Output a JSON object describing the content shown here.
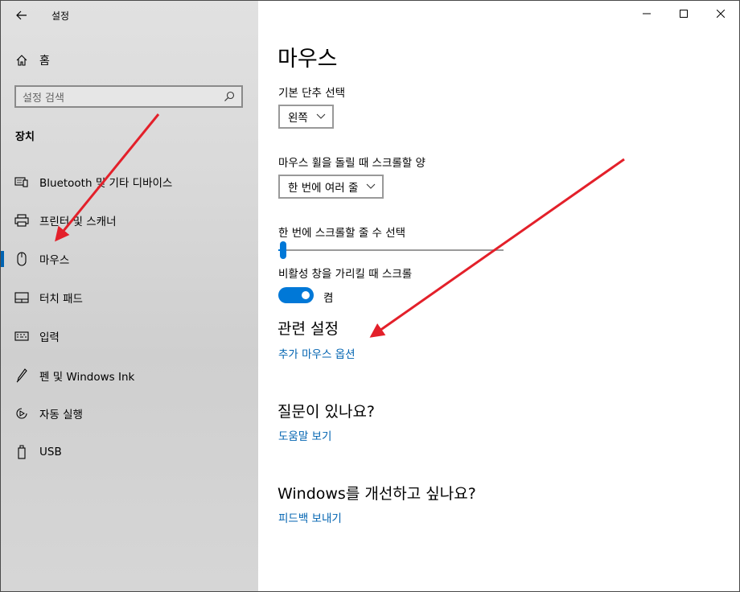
{
  "window": {
    "title": "설정",
    "controls": [
      "minimize",
      "maximize",
      "close"
    ]
  },
  "sidebar": {
    "home_label": "홈",
    "search_placeholder": "설정 검색",
    "section_title": "장치",
    "selected_index": 2,
    "items": [
      {
        "label": "Bluetooth 및 기타 디바이스",
        "icon": "bluetooth-devices-icon"
      },
      {
        "label": "프린터 및 스캐너",
        "icon": "printer-icon"
      },
      {
        "label": "마우스",
        "icon": "mouse-icon"
      },
      {
        "label": "터치 패드",
        "icon": "touchpad-icon"
      },
      {
        "label": "입력",
        "icon": "keyboard-icon"
      },
      {
        "label": "펜 및 Windows Ink",
        "icon": "pen-icon"
      },
      {
        "label": "자동 실행",
        "icon": "autoplay-icon"
      },
      {
        "label": "USB",
        "icon": "usb-icon"
      }
    ]
  },
  "main": {
    "title": "마우스",
    "primary_button": {
      "label": "기본 단추 선택",
      "value": "왼쪽"
    },
    "scroll_amount": {
      "label": "마우스 휠을 돌릴 때 스크롤할 양",
      "value": "한 번에 여러 줄"
    },
    "lines_to_scroll": {
      "label": "한 번에 스크롤할 줄 수 선택",
      "value": 3,
      "min": 1,
      "max": 100
    },
    "inactive_scroll": {
      "label": "비활성 창을 가리킬 때 스크롤",
      "state": "켬",
      "on": true
    },
    "related": {
      "title": "관련 설정",
      "link": "추가 마우스 옵션"
    },
    "question": {
      "title": "질문이 있나요?",
      "link": "도움말 보기"
    },
    "improve": {
      "title": "Windows를 개선하고 싶나요?",
      "link": "피드백 보내기"
    }
  },
  "colors": {
    "accent": "#0078d7",
    "link": "#0063b1",
    "annotation_arrow": "#e3202a"
  }
}
